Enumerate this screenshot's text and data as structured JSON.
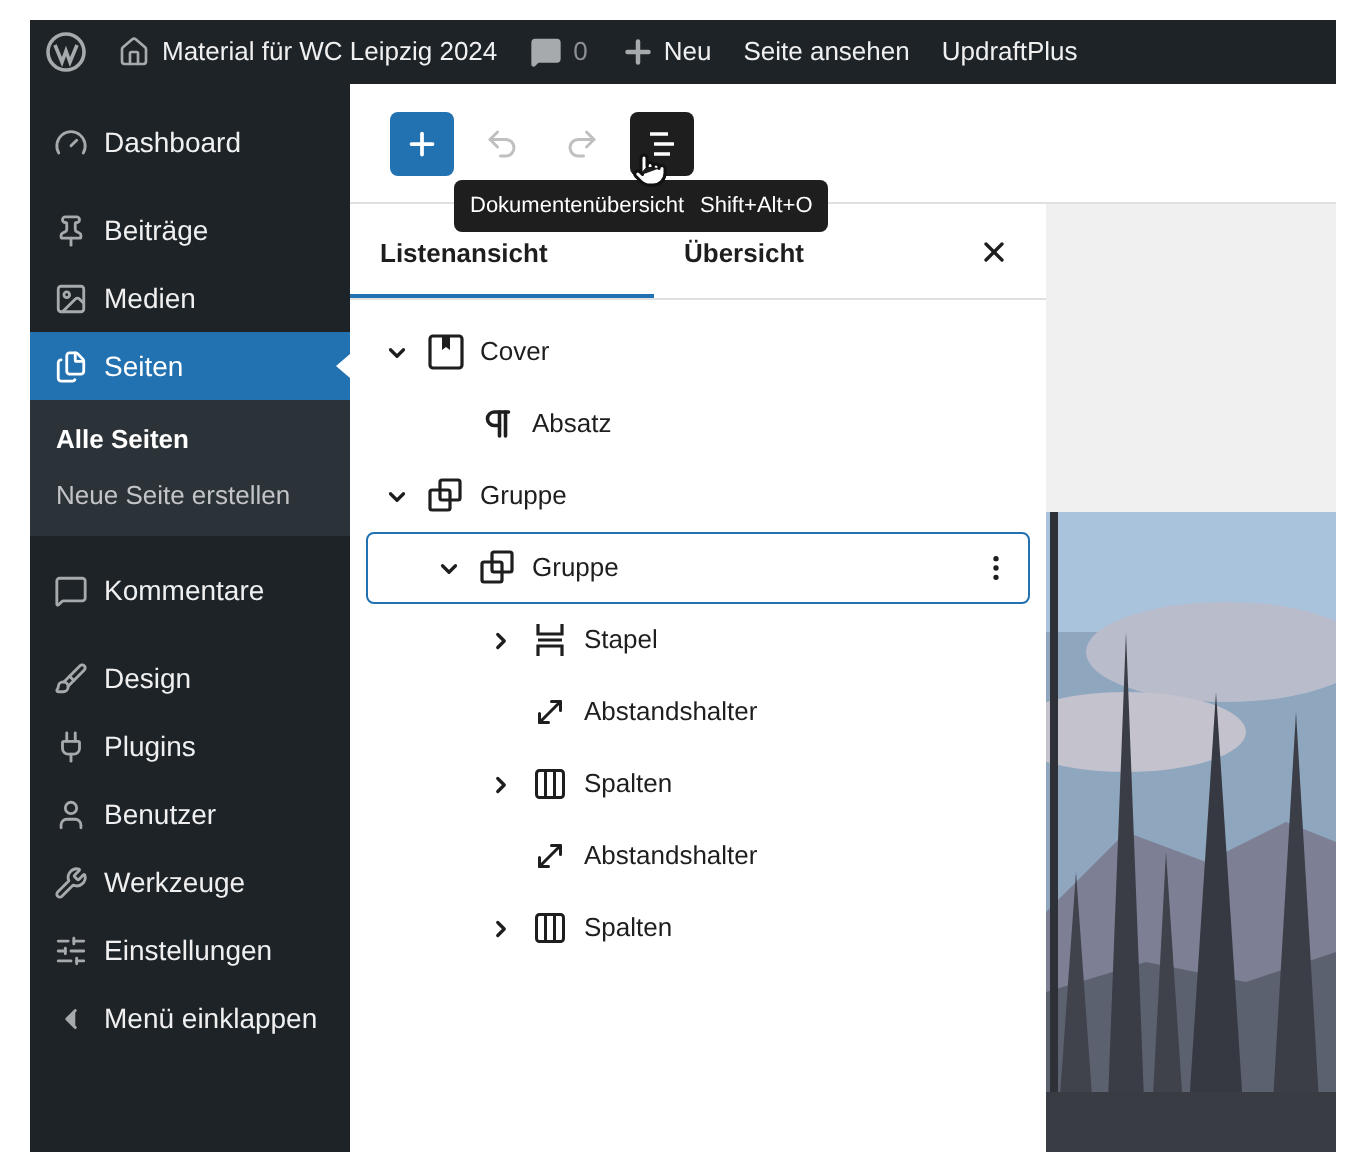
{
  "admin_bar": {
    "site_title": "Material für WC Leipzig 2024",
    "comments_count": "0",
    "new_label": "Neu",
    "view_page": "Seite ansehen",
    "plugin": "UpdraftPlus"
  },
  "sidebar": {
    "items": [
      {
        "label": "Dashboard",
        "selected": false
      },
      {
        "label": "Beiträge",
        "selected": false
      },
      {
        "label": "Medien",
        "selected": false
      },
      {
        "label": "Seiten",
        "selected": true,
        "children": [
          {
            "label": "Alle Seiten",
            "selected": true
          },
          {
            "label": "Neue Seite erstellen",
            "selected": false
          }
        ]
      },
      {
        "label": "Kommentare",
        "selected": false
      },
      {
        "label": "Design",
        "selected": false
      },
      {
        "label": "Plugins",
        "selected": false
      },
      {
        "label": "Benutzer",
        "selected": false
      },
      {
        "label": "Werkzeuge",
        "selected": false
      },
      {
        "label": "Einstellungen",
        "selected": false
      },
      {
        "label": "Menü einklappen",
        "selected": false
      }
    ]
  },
  "toolbar": {
    "undo_disabled": true,
    "redo_disabled": true,
    "list_view_active": true,
    "tooltip": {
      "label": "Dokumentenübersicht",
      "shortcut": "Shift+Alt+O"
    }
  },
  "list_view": {
    "tabs": [
      {
        "label": "Listenansicht",
        "selected": true
      },
      {
        "label": "Übersicht",
        "selected": false
      }
    ],
    "blocks": [
      {
        "kind": "cover",
        "label": "Cover",
        "expanded": true,
        "selected": false,
        "children": [
          {
            "kind": "paragraph",
            "label": "Absatz",
            "selected": false
          }
        ]
      },
      {
        "kind": "group",
        "label": "Gruppe",
        "expanded": true,
        "selected": false,
        "children": [
          {
            "kind": "group",
            "label": "Gruppe",
            "expanded": true,
            "selected": true,
            "children": [
              {
                "kind": "stack",
                "label": "Stapel",
                "expanded": false,
                "selected": false
              },
              {
                "kind": "spacer",
                "label": "Abstandshalter",
                "selected": false
              },
              {
                "kind": "columns",
                "label": "Spalten",
                "expanded": false,
                "selected": false
              },
              {
                "kind": "spacer",
                "label": "Abstandshalter",
                "selected": false
              },
              {
                "kind": "columns",
                "label": "Spalten",
                "expanded": false,
                "selected": false
              }
            ]
          }
        ]
      }
    ]
  }
}
